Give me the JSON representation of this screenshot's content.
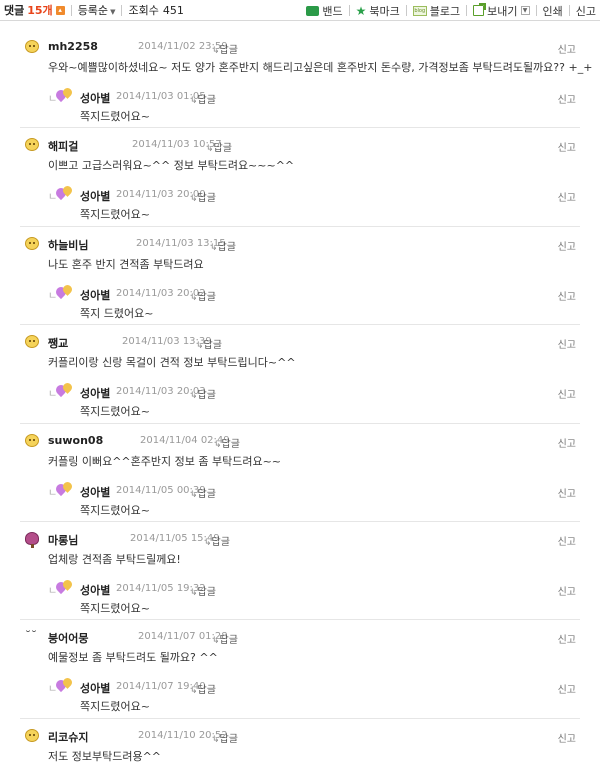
{
  "header": {
    "comment_label": "댓글",
    "comment_count": "15개",
    "sort_label": "등록순",
    "views_label": "조회수",
    "views_value": "451",
    "tools": {
      "band": "밴드",
      "bookmark": "북마크",
      "blog": "블로그",
      "blog_icon_text": "blog",
      "send": "보내기",
      "print": "인쇄",
      "report": "신고"
    }
  },
  "reply_label": "답글",
  "report_label": "신고",
  "comments": [
    {
      "author": "mh2258",
      "date": "2014/11/02 23:59",
      "body": "우와~예쁠많이하셨네요~ 저도 양가 혼주반지 해드리고싶은데 혼주반지 돈수량, 가격정보좀 부탁드려도될까요?? +_+",
      "reply": {
        "author": "성아별",
        "date": "2014/11/03 01:05",
        "body": "쪽지드렸어요~"
      }
    },
    {
      "author": "해피걸",
      "date": "2014/11/03 10:57",
      "body": "이쁘고 고급스러워요~^^ 정보 부탁드려요~~~^^",
      "reply": {
        "author": "성아별",
        "date": "2014/11/03 20:00",
        "body": "쪽지드렸어요~"
      }
    },
    {
      "author": "하늘비님",
      "date": "2014/11/03 13:15",
      "body": "나도 혼주 반지 견적좀 부탁드려요",
      "reply": {
        "author": "성아별",
        "date": "2014/11/03 20:02",
        "body": "쪽지 드렸어요~"
      }
    },
    {
      "author": "쨍교",
      "date": "2014/11/03 13:39",
      "body": "커플리이랑 신랑 목걸이 견적 정보 부탁드립니다~^^",
      "reply": {
        "author": "성아별",
        "date": "2014/11/03 20:03",
        "body": "쪽지드렸어요~"
      }
    },
    {
      "author": "suwon08",
      "date": "2014/11/04 02:49",
      "body": "커플링 이뻐요^^혼주반지 정보 좀 부탁드려요~~",
      "reply": {
        "author": "성아별",
        "date": "2014/11/05 00:39",
        "body": "쪽지드렸어요~"
      }
    },
    {
      "author": "마롱님",
      "date": "2014/11/05 15:49",
      "body": "업체랑 견적좀 부탁드릴께요!",
      "reply": {
        "author": "성아별",
        "date": "2014/11/05 19:32",
        "body": "쪽지드렸어요~"
      }
    },
    {
      "author": "붕어어뭉",
      "date": "2014/11/07 01:28",
      "body": "예물정보 좀 부탁드려도 될까요? ^^",
      "reply": {
        "author": "성아별",
        "date": "2014/11/07 19:40",
        "body": "쪽지드렸어요~"
      }
    },
    {
      "author": "리코슈지",
      "date": "2014/11/10 20:52",
      "body": "저도 정보부탁드려용^^"
    }
  ]
}
